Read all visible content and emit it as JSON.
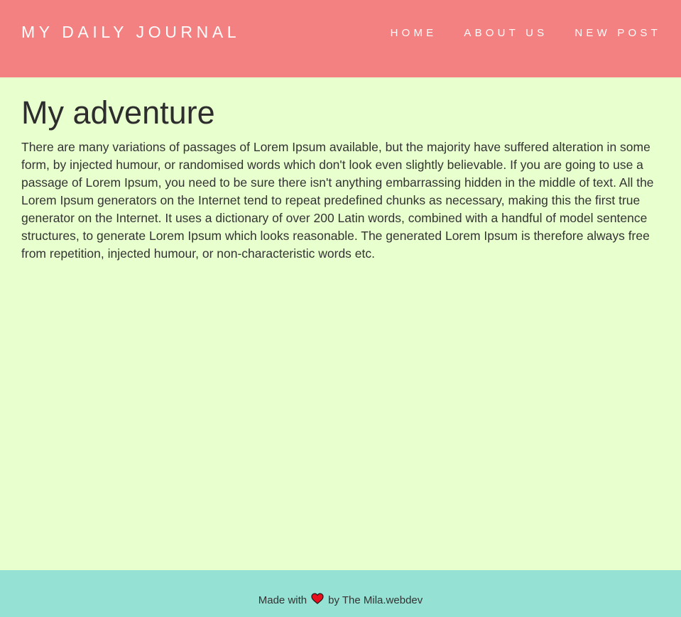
{
  "header": {
    "brand": "MY DAILY JOURNAL",
    "nav": [
      {
        "label": "HOME"
      },
      {
        "label": "ABOUT US"
      },
      {
        "label": "NEW POST"
      }
    ]
  },
  "post": {
    "title": "My adventure",
    "body": "There are many variations of passages of Lorem Ipsum available, but the majority have suffered alteration in some form, by injected humour, or randomised words which don't look even slightly believable. If you are going to use a passage of Lorem Ipsum, you need to be sure there isn't anything embarrassing hidden in the middle of text. All the Lorem Ipsum generators on the Internet tend to repeat predefined chunks as necessary, making this the first true generator on the Internet. It uses a dictionary of over 200 Latin words, combined with a handful of model sentence structures, to generate Lorem Ipsum which looks reasonable. The generated Lorem Ipsum is therefore always free from repetition, injected humour, or non-characteristic words etc."
  },
  "footer": {
    "prefix": "Made with",
    "icon": "heart-icon",
    "suffix": "by The Mila.webdev"
  },
  "colors": {
    "header_bg": "#f38181",
    "page_bg": "#e8ffce",
    "footer_bg": "#95e1d3",
    "heart": "#e8101d"
  }
}
